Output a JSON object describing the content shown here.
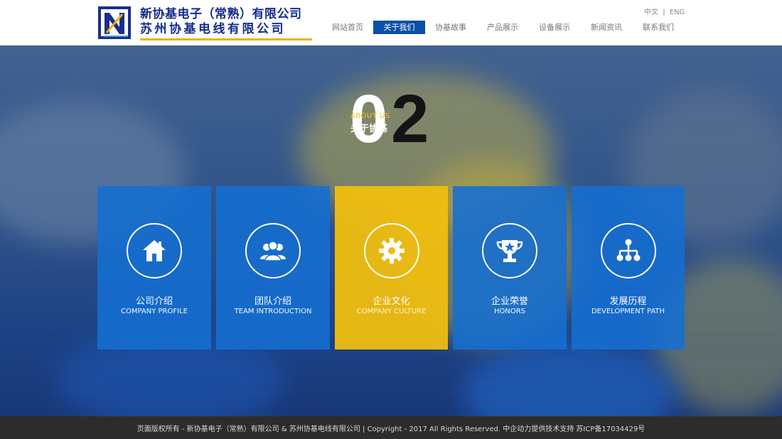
{
  "company": {
    "name_line1": "新协基电子（常熟）有限公司",
    "name_line2": "苏州协基电线有限公司",
    "logo_letter": "N"
  },
  "lang": {
    "zh": "中文",
    "sep": "|",
    "en": "ENG"
  },
  "nav": [
    {
      "label": "网站首页",
      "active": false
    },
    {
      "label": "关于我们",
      "active": true
    },
    {
      "label": "协基故事",
      "active": false
    },
    {
      "label": "产品展示",
      "active": false
    },
    {
      "label": "设备展示",
      "active": false
    },
    {
      "label": "新闻资讯",
      "active": false
    },
    {
      "label": "联系我们",
      "active": false
    }
  ],
  "section": {
    "digit0": "0",
    "digit2": "2",
    "label_en": "ABOUT US",
    "label_cn": "关于协基"
  },
  "tiles": [
    {
      "cn": "公司介绍",
      "en": "COMPANY PROFILE",
      "icon": "house-icon",
      "color": "#1670d4"
    },
    {
      "cn": "团队介绍",
      "en": "TEAM INTRODUCTION",
      "icon": "team-icon",
      "color": "#1670d4"
    },
    {
      "cn": "企业文化",
      "en": "COMPANY CULTURE",
      "icon": "gear-icon",
      "color": "#f0be0f"
    },
    {
      "cn": "企业荣誉",
      "en": "HONORS",
      "icon": "trophy-icon",
      "color": "#1670d4"
    },
    {
      "cn": "发展历程",
      "en": "DEVELOPMENT PATH",
      "icon": "org-chart-icon",
      "color": "#1670d4"
    }
  ],
  "footer": {
    "text": "页面版权所有 - 新协基电子（常熟）有限公司 & 苏州协基电线有限公司 | Copyright - 2017 All Rights Reserved. 中企动力提供技术支持 苏ICP备17034429号"
  }
}
